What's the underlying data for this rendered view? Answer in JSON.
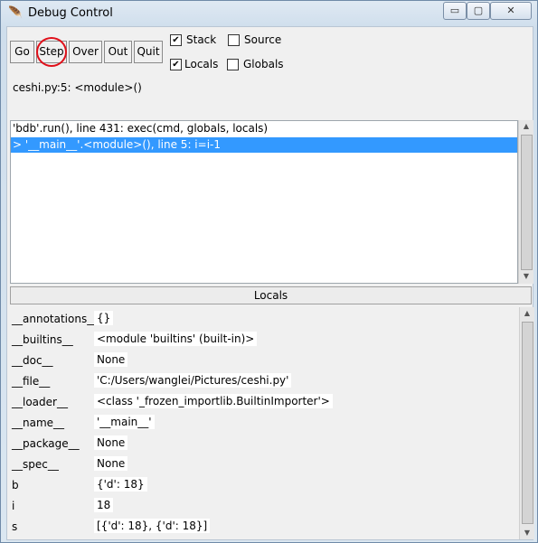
{
  "window": {
    "title": "Debug Control",
    "app_icon": "python-feather-icon",
    "controls": {
      "minimize": "▭",
      "maximize": "▢",
      "close": "✕"
    }
  },
  "toolbar": {
    "buttons": [
      "Go",
      "Step",
      "Over",
      "Out",
      "Quit"
    ],
    "highlighted_button": "Step",
    "highlight_color": "#e0101a"
  },
  "options": {
    "stack": {
      "label": "Stack",
      "checked": true
    },
    "source": {
      "label": "Source",
      "checked": false
    },
    "locals": {
      "label": "Locals",
      "checked": true
    },
    "globals": {
      "label": "Globals",
      "checked": false
    }
  },
  "status_line": "ceshi.py:5: <module>()",
  "stack": {
    "lines": [
      "'bdb'.run(), line 431: exec(cmd, globals, locals)",
      "> '__main__'.<module>(), line 5: i=i-1"
    ],
    "selected_index": 1,
    "selection_color": "#3399ff"
  },
  "locals": {
    "header": "Locals",
    "rows": [
      {
        "name": "__annotations__",
        "value": "{}"
      },
      {
        "name": "__builtins__",
        "value": "<module 'builtins' (built-in)>"
      },
      {
        "name": "__doc__",
        "value": "None"
      },
      {
        "name": "__file__",
        "value": "'C:/Users/wanglei/Pictures/ceshi.py'"
      },
      {
        "name": "__loader__",
        "value": "<class '_frozen_importlib.BuiltinImporter'>"
      },
      {
        "name": "__name__",
        "value": "'__main__'"
      },
      {
        "name": "__package__",
        "value": "None"
      },
      {
        "name": "__spec__",
        "value": "None"
      },
      {
        "name": "b",
        "value": "{'d': 18}"
      },
      {
        "name": "i",
        "value": "18"
      },
      {
        "name": "s",
        "value": "[{'d': 18}, {'d': 18}]"
      }
    ]
  }
}
